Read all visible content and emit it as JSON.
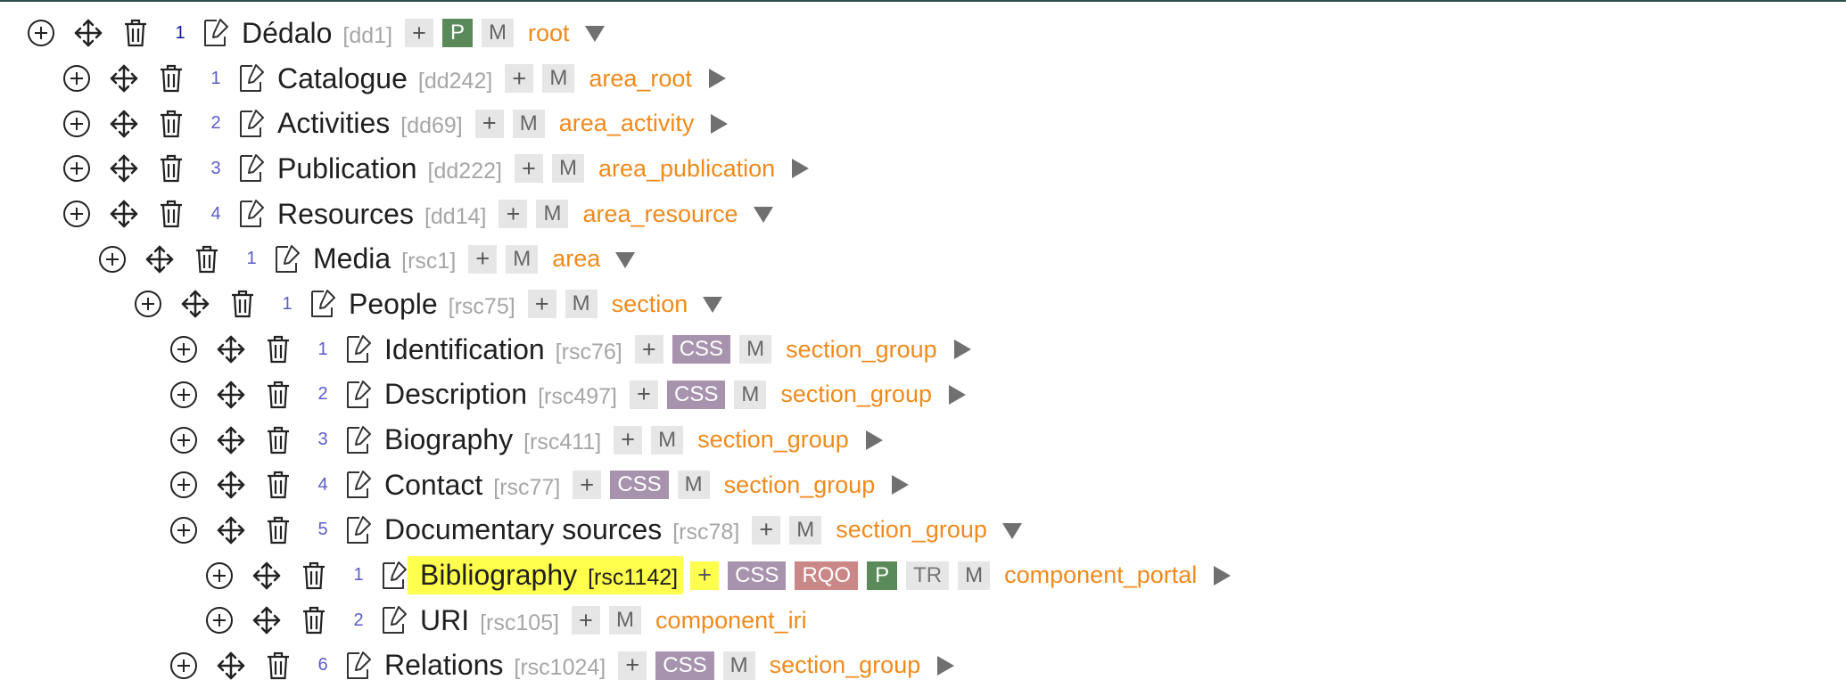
{
  "colors": {
    "term": "#1f1f1f",
    "tipo": "#a6a6a6",
    "model": "#f08a1c",
    "order": "#5c5cc9",
    "tag_p": "#5a8a5a",
    "tag_css": "#a793ad",
    "tag_rqo": "#c98787",
    "tag_m": "#e6e6e6",
    "highlight": "#ffff4d",
    "top_border": "#2f4f4f"
  },
  "icons": {
    "add": "circle-plus-icon",
    "move": "move-arrows-icon",
    "delete": "trash-icon",
    "edit": "edit-document-icon",
    "expand": "triangle-right-icon",
    "collapse": "triangle-down-icon"
  },
  "add_label": "+",
  "tree": [
    {
      "depth": 0,
      "order": "1",
      "term": "Dédalo",
      "tipo": "[dd1]",
      "tags": [
        "P",
        "M"
      ],
      "model": "root",
      "expanded": true
    },
    {
      "depth": 1,
      "order": "1",
      "term": "Catalogue",
      "tipo": "[dd242]",
      "tags": [
        "M"
      ],
      "model": "area_root",
      "expanded": false
    },
    {
      "depth": 1,
      "order": "2",
      "term": "Activities",
      "tipo": "[dd69]",
      "tags": [
        "M"
      ],
      "model": "area_activity",
      "expanded": false
    },
    {
      "depth": 1,
      "order": "3",
      "term": "Publication",
      "tipo": "[dd222]",
      "tags": [
        "M"
      ],
      "model": "area_publication",
      "expanded": false
    },
    {
      "depth": 1,
      "order": "4",
      "term": "Resources",
      "tipo": "[dd14]",
      "tags": [
        "M"
      ],
      "model": "area_resource",
      "expanded": true
    },
    {
      "depth": 2,
      "order": "1",
      "term": "Media",
      "tipo": "[rsc1]",
      "tags": [
        "M"
      ],
      "model": "area",
      "expanded": true
    },
    {
      "depth": 3,
      "order": "1",
      "term": "People",
      "tipo": "[rsc75]",
      "tags": [
        "M"
      ],
      "model": "section",
      "expanded": true
    },
    {
      "depth": 4,
      "order": "1",
      "term": "Identification",
      "tipo": "[rsc76]",
      "tags": [
        "CSS",
        "M"
      ],
      "model": "section_group",
      "expanded": false
    },
    {
      "depth": 4,
      "order": "2",
      "term": "Description",
      "tipo": "[rsc497]",
      "tags": [
        "CSS",
        "M"
      ],
      "model": "section_group",
      "expanded": false
    },
    {
      "depth": 4,
      "order": "3",
      "term": "Biography",
      "tipo": "[rsc411]",
      "tags": [
        "M"
      ],
      "model": "section_group",
      "expanded": false
    },
    {
      "depth": 4,
      "order": "4",
      "term": "Contact",
      "tipo": "[rsc77]",
      "tags": [
        "CSS",
        "M"
      ],
      "model": "section_group",
      "expanded": false
    },
    {
      "depth": 4,
      "order": "5",
      "term": "Documentary sources",
      "tipo": "[rsc78]",
      "tags": [
        "M"
      ],
      "model": "section_group",
      "expanded": true
    },
    {
      "depth": 5,
      "order": "1",
      "term": "Bibliography",
      "tipo": "[rsc1142]",
      "tags": [
        "CSS",
        "RQO",
        "P",
        "TR",
        "M"
      ],
      "model": "component_portal",
      "expanded": false,
      "highlighted": true
    },
    {
      "depth": 5,
      "order": "2",
      "term": "URI",
      "tipo": "[rsc105]",
      "tags": [
        "M"
      ],
      "model": "component_iri",
      "leaf": true
    },
    {
      "depth": 4,
      "order": "6",
      "term": "Relations",
      "tipo": "[rsc1024]",
      "tags": [
        "CSS",
        "M"
      ],
      "model": "section_group",
      "expanded": false
    }
  ]
}
